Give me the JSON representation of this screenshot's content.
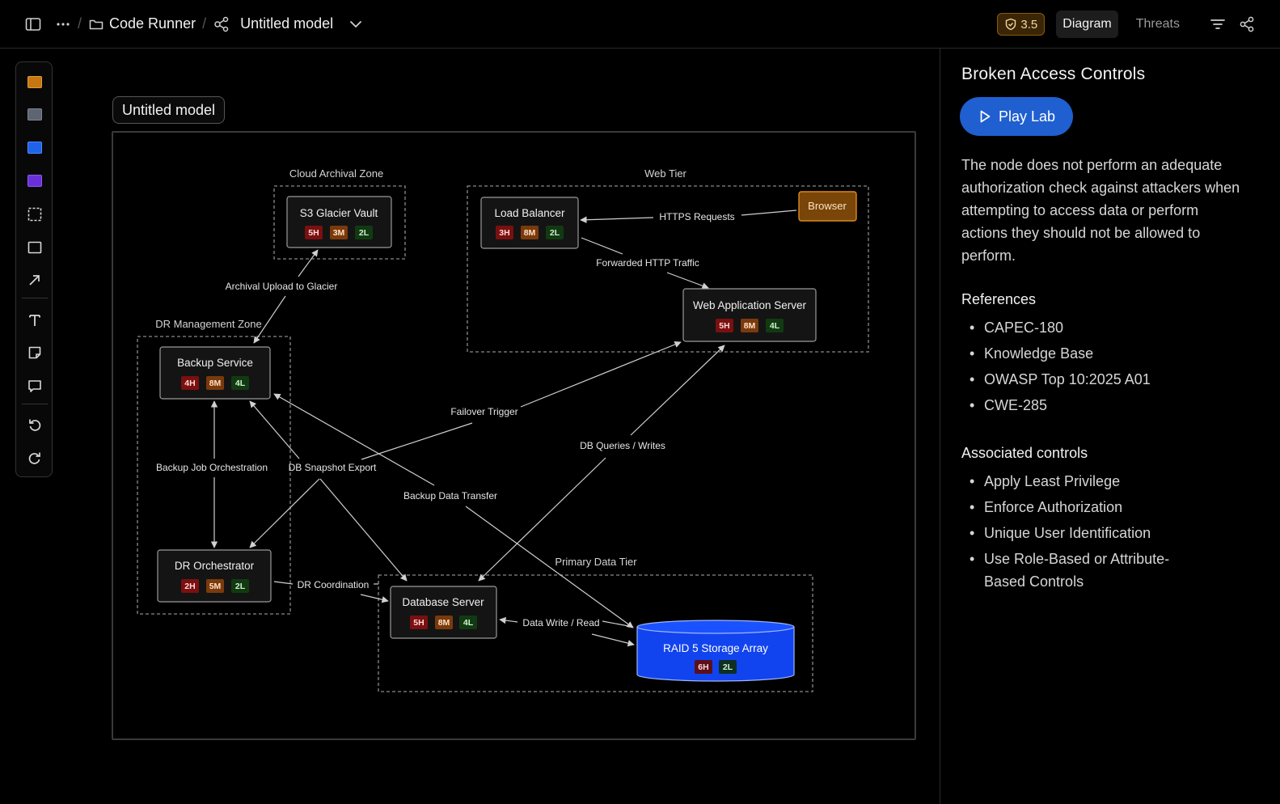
{
  "topbar": {
    "crumb_project": "Code Runner",
    "crumb_model": "Untitled model",
    "score": "3.5",
    "tab_diagram": "Diagram",
    "tab_threats": "Threats"
  },
  "canvas": {
    "model_label": "Untitled model"
  },
  "diagram": {
    "zones": [
      {
        "id": "z-cloud",
        "label": "Cloud Archival Zone"
      },
      {
        "id": "z-web",
        "label": "Web Tier"
      },
      {
        "id": "z-dr",
        "label": "DR Management Zone"
      },
      {
        "id": "z-data",
        "label": "Primary Data Tier"
      }
    ],
    "nodes": [
      {
        "id": "glacier",
        "label": "S3 Glacier Vault",
        "badges": [
          "5H",
          "3M",
          "2L"
        ]
      },
      {
        "id": "lb",
        "label": "Load Balancer",
        "badges": [
          "3H",
          "8M",
          "2L"
        ]
      },
      {
        "id": "browser",
        "label": "Browser",
        "badges": []
      },
      {
        "id": "was",
        "label": "Web Application Server",
        "badges": [
          "5H",
          "8M",
          "4L"
        ]
      },
      {
        "id": "backup",
        "label": "Backup Service",
        "badges": [
          "4H",
          "8M",
          "4L"
        ]
      },
      {
        "id": "dro",
        "label": "DR Orchestrator",
        "badges": [
          "2H",
          "5M",
          "2L"
        ]
      },
      {
        "id": "db",
        "label": "Database Server",
        "badges": [
          "5H",
          "8M",
          "4L"
        ]
      },
      {
        "id": "raid",
        "label": "RAID 5 Storage Array",
        "badges": [
          "6H",
          "2L"
        ]
      }
    ],
    "edges": [
      {
        "id": "e-https",
        "label": "HTTPS Requests"
      },
      {
        "id": "e-fwd",
        "label": "Forwarded HTTP Traffic"
      },
      {
        "id": "e-arch",
        "label": "Archival Upload to Glacier"
      },
      {
        "id": "e-failover",
        "label": "Failover Trigger"
      },
      {
        "id": "e-dbq",
        "label": "DB Queries / Writes"
      },
      {
        "id": "e-bjo",
        "label": "Backup Job Orchestration"
      },
      {
        "id": "e-snap",
        "label": "DB Snapshot Export"
      },
      {
        "id": "e-bdt",
        "label": "Backup Data Transfer"
      },
      {
        "id": "e-drc",
        "label": "DR Coordination"
      },
      {
        "id": "e-dwr",
        "label": "Data Write / Read"
      }
    ],
    "colors": {
      "high": "#7a1010",
      "medium": "#7a3a0c",
      "low": "#123a12",
      "browser": "#b06a14",
      "raid": "#1144ee"
    }
  },
  "panel": {
    "title": "Broken Access Controls",
    "play_label": "Play Lab",
    "description": "The node does not perform an adequate authorization check against attackers when attempting to access data or perform actions they should not be allowed to perform.",
    "references_title": "References",
    "references": [
      "CAPEC-180",
      "Knowledge Base",
      "OWASP Top 10:2025 A01",
      "CWE-285"
    ],
    "controls_title": "Associated controls",
    "controls": [
      "Apply Least Privilege",
      "Enforce Authorization",
      "Unique User Identification",
      "Use Role-Based or Attribute-Based Controls"
    ]
  }
}
